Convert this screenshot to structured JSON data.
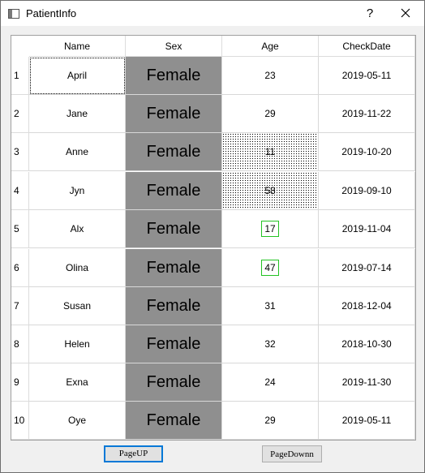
{
  "window": {
    "title": "PatientInfo",
    "help_label": "?"
  },
  "table": {
    "columns": [
      "Name",
      "Sex",
      "Age",
      "CheckDate"
    ],
    "rows": [
      {
        "num": "1",
        "name": "April",
        "sex": "Female",
        "age": "23",
        "date": "2019-05-11"
      },
      {
        "num": "2",
        "name": "Jane",
        "sex": "Female",
        "age": "29",
        "date": "2019-11-22"
      },
      {
        "num": "3",
        "name": "Anne",
        "sex": "Female",
        "age": "11",
        "date": "2019-10-20"
      },
      {
        "num": "4",
        "name": "Jyn",
        "sex": "Female",
        "age": "58",
        "date": "2019-09-10"
      },
      {
        "num": "5",
        "name": "Alx",
        "sex": "Female",
        "age": "17",
        "date": "2019-11-04"
      },
      {
        "num": "6",
        "name": "Olina",
        "sex": "Female",
        "age": "47",
        "date": "2019-07-14"
      },
      {
        "num": "7",
        "name": "Susan",
        "sex": "Female",
        "age": "31",
        "date": "2018-12-04"
      },
      {
        "num": "8",
        "name": "Helen",
        "sex": "Female",
        "age": "32",
        "date": "2018-10-30"
      },
      {
        "num": "9",
        "name": "Exna",
        "sex": "Female",
        "age": "24",
        "date": "2019-11-30"
      },
      {
        "num": "10",
        "name": "Oye",
        "sex": "Female",
        "age": "29",
        "date": "2019-05-11"
      }
    ]
  },
  "buttons": {
    "page_up": "PageUP",
    "page_down": "PageDownn"
  },
  "colors": {
    "sex_cell": "#8f8f8f",
    "age_highlight_border": "#23c323",
    "primary_button_border": "#0078d7"
  }
}
